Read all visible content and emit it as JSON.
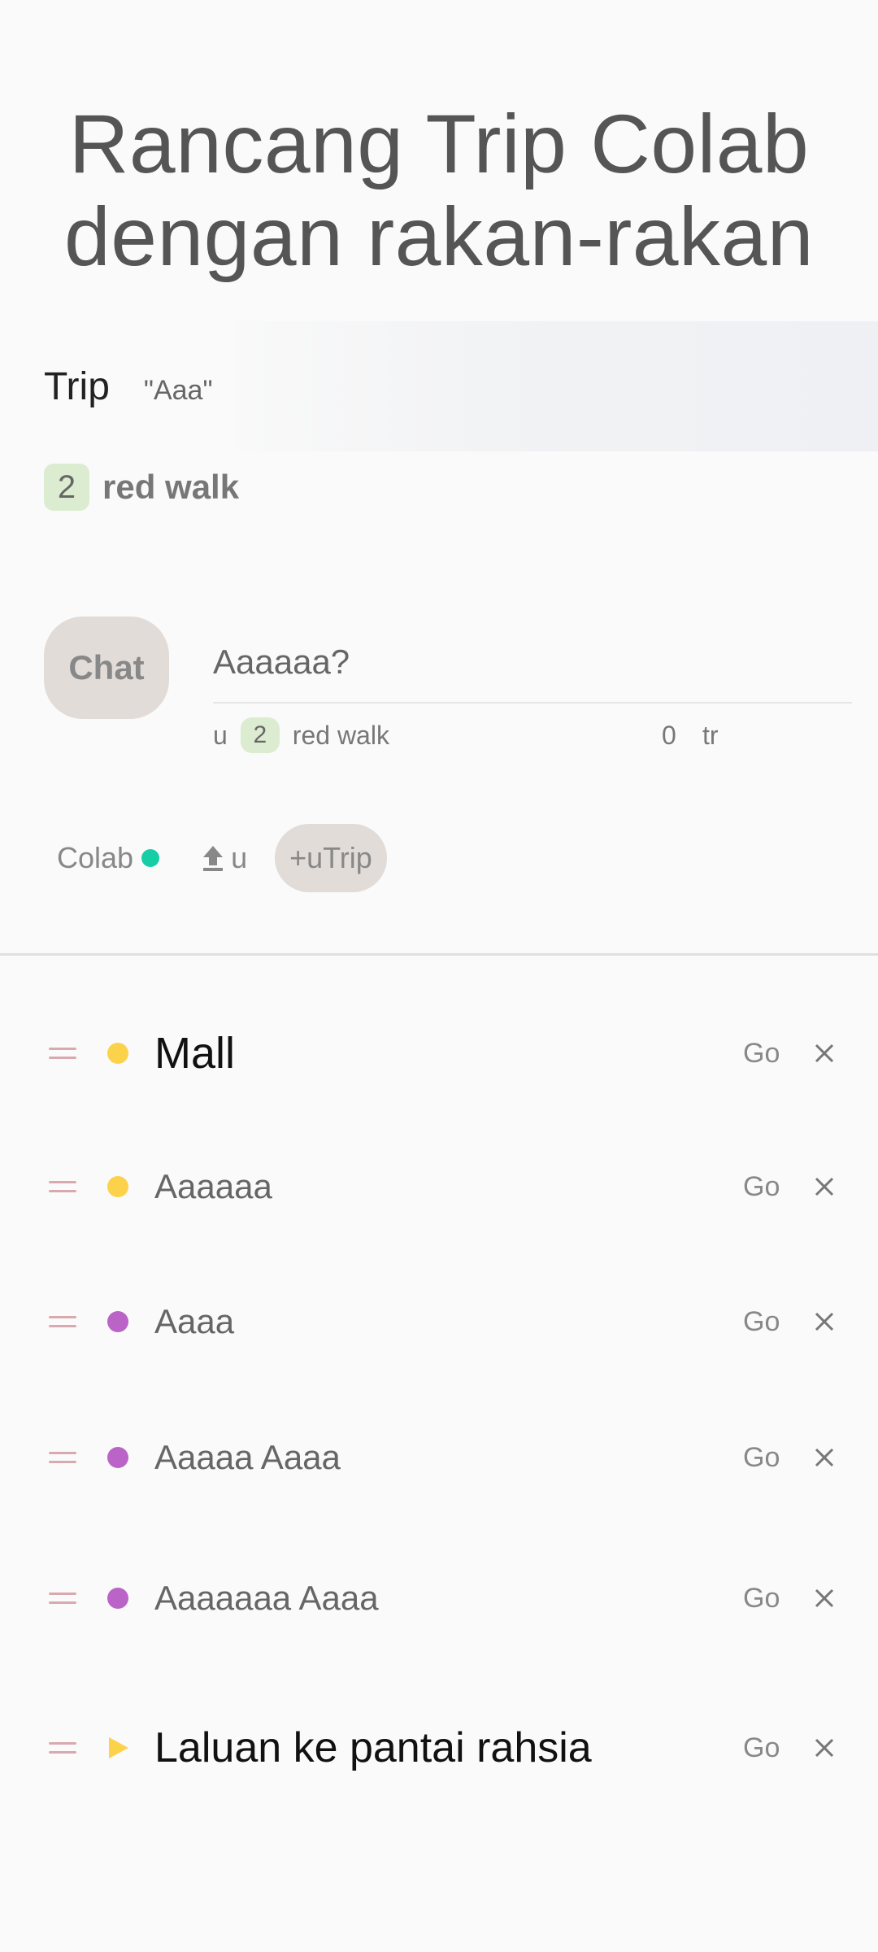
{
  "hero": {
    "line1": "Rancang Trip Colab",
    "line2": "dengan rakan-rakan"
  },
  "trip": {
    "label": "Trip",
    "name": "\"Aaa\""
  },
  "summary": {
    "count": "2",
    "text": "red walk"
  },
  "chat": {
    "button_label": "Chat",
    "input_value": "Aaaaaa?",
    "meta": {
      "prefix": "u",
      "count": "2",
      "text": "red walk",
      "zero": "0",
      "suffix": "tr"
    }
  },
  "actions": {
    "colab_label": "Colab",
    "upload_label": "u",
    "add_trip_label": "+uTrip"
  },
  "items": [
    {
      "label": "Mall",
      "marker": "yellow",
      "go": "Go"
    },
    {
      "label": "Aaaaaa",
      "marker": "yellow",
      "go": "Go"
    },
    {
      "label": "Aaaa",
      "marker": "purple",
      "go": "Go"
    },
    {
      "label": "Aaaaa Aaaa",
      "marker": "purple",
      "go": "Go"
    },
    {
      "label": "Aaaaaaa Aaaa",
      "marker": "purple",
      "go": "Go"
    },
    {
      "label": "Laluan ke pantai rahsia",
      "marker": "play-yellow",
      "go": "Go"
    }
  ],
  "colors": {
    "accent_online": "#16cea5",
    "marker_yellow": "#fdd24b",
    "marker_purple": "#bb64c8",
    "badge_green": "#dcecd1",
    "pill_bg": "#e2dcd8"
  }
}
